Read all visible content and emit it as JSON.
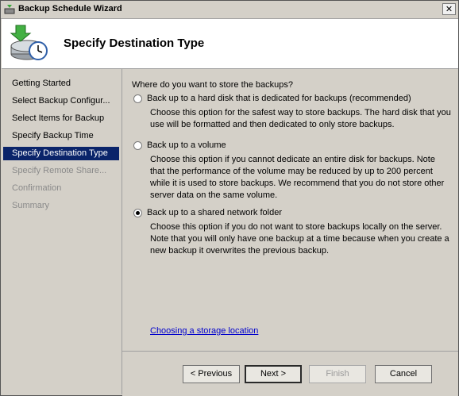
{
  "window": {
    "title": "Backup Schedule Wizard",
    "close_glyph": "✕"
  },
  "header": {
    "title": "Specify Destination Type",
    "icon": "backup-schedule-icon"
  },
  "sidebar": {
    "items": [
      {
        "label": "Getting Started",
        "state": "normal"
      },
      {
        "label": "Select Backup Configur...",
        "state": "normal"
      },
      {
        "label": "Select Items for Backup",
        "state": "normal"
      },
      {
        "label": "Specify Backup Time",
        "state": "normal"
      },
      {
        "label": "Specify Destination Type",
        "state": "active"
      },
      {
        "label": "Specify Remote Share...",
        "state": "disabled"
      },
      {
        "label": "Confirmation",
        "state": "disabled"
      },
      {
        "label": "Summary",
        "state": "disabled"
      }
    ]
  },
  "main": {
    "question": "Where do you want to store the backups?",
    "options": [
      {
        "label": "Back up to a hard disk that is dedicated for backups (recommended)",
        "description": "Choose this option for the safest way to store backups. The hard disk that you use will be formatted and then dedicated to only store backups.",
        "selected": false
      },
      {
        "label": "Back up to a volume",
        "description": "Choose this option if you cannot dedicate an entire disk for backups. Note that the performance of the volume may be reduced by up to 200 percent while it is used to store backups. We recommend that you do not store other server data on the same volume.",
        "selected": false
      },
      {
        "label": "Back up to a shared network folder",
        "description": "Choose this option if you do not want to store backups locally on the server. Note that you will only have one backup at a time because when you create a new backup it overwrites the previous backup.",
        "selected": true
      }
    ],
    "link": "Choosing a storage location"
  },
  "buttons": {
    "previous": "< Previous",
    "next": "Next >",
    "finish": "Finish",
    "cancel": "Cancel"
  }
}
